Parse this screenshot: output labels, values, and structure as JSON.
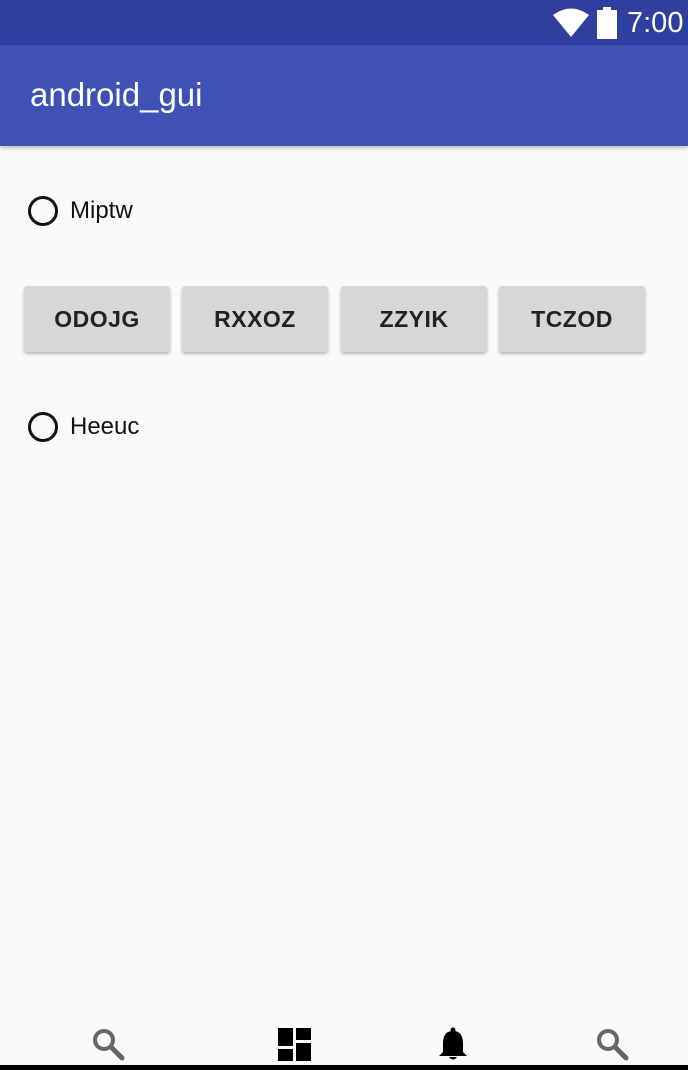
{
  "status_bar": {
    "time": "7:00",
    "icons": [
      "wifi-icon",
      "battery-icon"
    ]
  },
  "app_bar": {
    "title": "android_gui"
  },
  "radio_buttons": [
    {
      "label": "Miptw",
      "checked": false
    },
    {
      "label": "Heeuc",
      "checked": false
    }
  ],
  "buttons": [
    {
      "label": "ODOJG"
    },
    {
      "label": "RXXOZ"
    },
    {
      "label": "ZZYIK"
    },
    {
      "label": "TCZOD"
    }
  ],
  "bottom_nav": {
    "items": [
      {
        "icon": "search-icon"
      },
      {
        "icon": "dashboard-icon"
      },
      {
        "icon": "bell-icon"
      },
      {
        "icon": "search-icon"
      }
    ]
  },
  "colors": {
    "status_bar": "#303f9f",
    "app_bar": "#3f51b5",
    "background": "#fafafa",
    "button": "#d6d7d7"
  }
}
